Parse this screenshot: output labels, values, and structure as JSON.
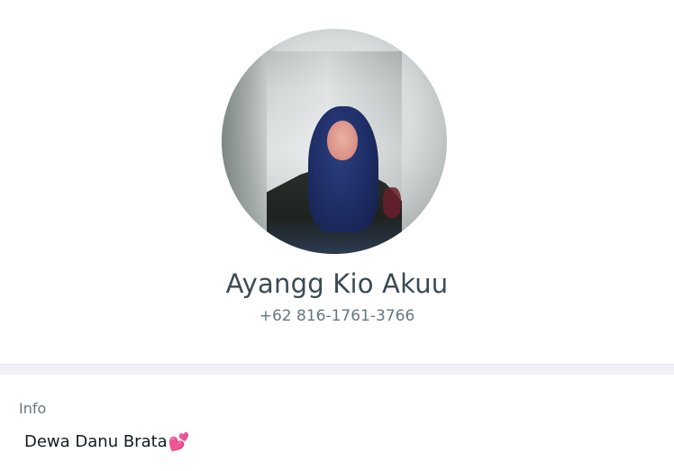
{
  "contact": {
    "name": "Ayangg Kio Akuu",
    "phone": "+62 816-1761-3766"
  },
  "info": {
    "label": "Info",
    "about": "Dewa Danu Brata",
    "about_emoji": "💕"
  },
  "icons": {
    "avatar": "profile-photo"
  },
  "colors": {
    "name_text": "#3b4a54",
    "secondary_text": "#667781",
    "primary_text": "#111b21",
    "separator": "#f0f2f5",
    "emoji_pink": "#f06aa6"
  }
}
